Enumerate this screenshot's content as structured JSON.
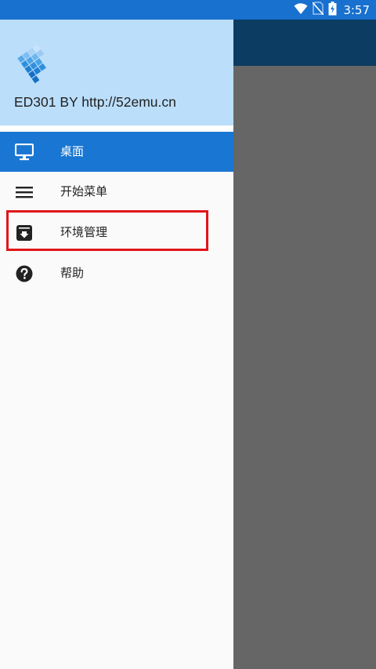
{
  "status_bar": {
    "time": "3:57",
    "icons": [
      "wifi-icon",
      "no-sim-icon",
      "battery-charging-icon"
    ],
    "color": "#1870cf"
  },
  "drawer": {
    "header_title": "ED301 BY http://52emu.cn",
    "header_color": "#bbdefb",
    "items": [
      {
        "label": "桌面",
        "icon": "monitor-icon",
        "active": true
      },
      {
        "label": "开始菜单",
        "icon": "menu-icon",
        "active": false
      },
      {
        "label": "环境管理",
        "icon": "archive-icon",
        "active": false,
        "highlighted": true
      },
      {
        "label": "帮助",
        "icon": "help-icon",
        "active": false
      }
    ],
    "active_color": "#1976d2"
  },
  "highlight_color": "#e0161a",
  "app": {
    "toolbar_color": "#0c3c61",
    "scrim_color": "#666666"
  }
}
